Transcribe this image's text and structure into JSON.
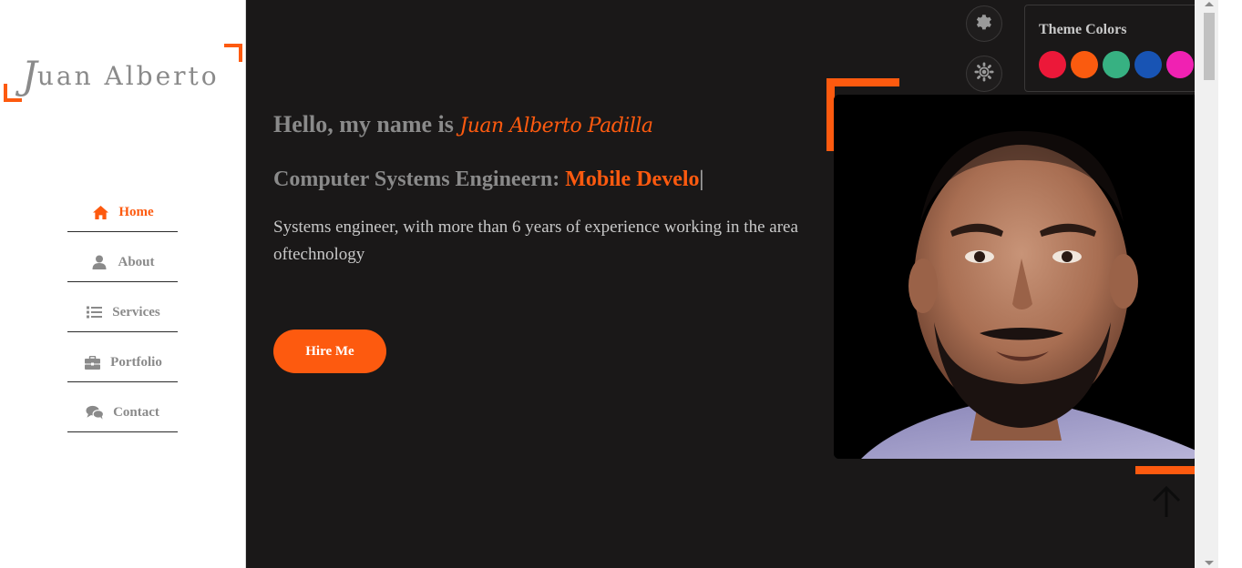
{
  "sidebar": {
    "logo_initial": "J",
    "logo_rest": "uan Alberto",
    "items": [
      {
        "label": "Home",
        "icon": "home-icon",
        "active": true
      },
      {
        "label": "About",
        "icon": "user-icon",
        "active": false
      },
      {
        "label": "Services",
        "icon": "list-icon",
        "active": false
      },
      {
        "label": "Portfolio",
        "icon": "briefcase-icon",
        "active": false
      },
      {
        "label": "Contact",
        "icon": "chat-icon",
        "active": false
      }
    ]
  },
  "hero": {
    "greeting_prefix": "Hello, my name is ",
    "name": "Juan Alberto Padilla",
    "title_prefix": "Computer Systems Engineern: ",
    "title_typed": "Mobile Develo",
    "cursor": "|",
    "description": "Systems engineer, with more than 6 years of experience working in the area oftechnology",
    "hire_label": "Hire Me"
  },
  "theme": {
    "title": "Theme Colors",
    "accent": "#fd5a0f",
    "background": "#1a1818",
    "colors": [
      "#ec1839",
      "#fa5b0f",
      "#37b182",
      "#1854b4",
      "#f021b2"
    ]
  },
  "icons": {
    "settings": "gear-icon",
    "theme_toggle": "sun-icon",
    "back_to_top": "arrow-up-icon"
  }
}
